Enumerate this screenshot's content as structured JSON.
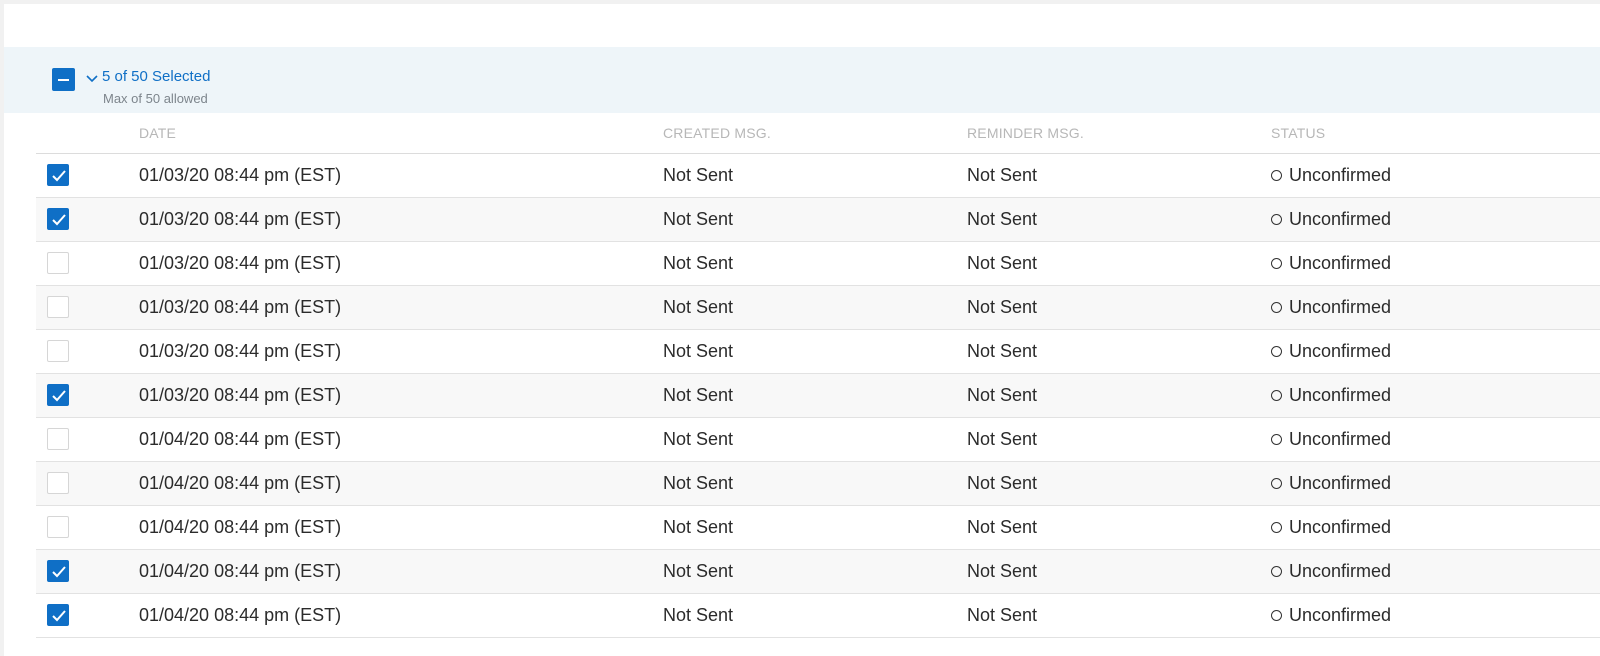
{
  "selection": {
    "summary": "5 of 50 Selected",
    "limit_note": "Max of 50 allowed"
  },
  "columns": {
    "date": "DATE",
    "created": "CREATED MSG.",
    "reminder": "REMINDER MSG.",
    "status": "STATUS"
  },
  "rows": [
    {
      "checked": true,
      "date": "01/03/20 08:44 pm (EST)",
      "created": "Not Sent",
      "reminder": "Not Sent",
      "status": "Unconfirmed"
    },
    {
      "checked": true,
      "date": "01/03/20 08:44 pm (EST)",
      "created": "Not Sent",
      "reminder": "Not Sent",
      "status": "Unconfirmed"
    },
    {
      "checked": false,
      "date": "01/03/20 08:44 pm (EST)",
      "created": "Not Sent",
      "reminder": "Not Sent",
      "status": "Unconfirmed"
    },
    {
      "checked": false,
      "date": "01/03/20 08:44 pm (EST)",
      "created": "Not Sent",
      "reminder": "Not Sent",
      "status": "Unconfirmed"
    },
    {
      "checked": false,
      "date": "01/03/20 08:44 pm (EST)",
      "created": "Not Sent",
      "reminder": "Not Sent",
      "status": "Unconfirmed"
    },
    {
      "checked": true,
      "date": "01/03/20 08:44 pm (EST)",
      "created": "Not Sent",
      "reminder": "Not Sent",
      "status": "Unconfirmed"
    },
    {
      "checked": false,
      "date": "01/04/20 08:44 pm (EST)",
      "created": "Not Sent",
      "reminder": "Not Sent",
      "status": "Unconfirmed"
    },
    {
      "checked": false,
      "date": "01/04/20 08:44 pm (EST)",
      "created": "Not Sent",
      "reminder": "Not Sent",
      "status": "Unconfirmed"
    },
    {
      "checked": false,
      "date": "01/04/20 08:44 pm (EST)",
      "created": "Not Sent",
      "reminder": "Not Sent",
      "status": "Unconfirmed"
    },
    {
      "checked": true,
      "date": "01/04/20 08:44 pm (EST)",
      "created": "Not Sent",
      "reminder": "Not Sent",
      "status": "Unconfirmed"
    },
    {
      "checked": true,
      "date": "01/04/20 08:44 pm (EST)",
      "created": "Not Sent",
      "reminder": "Not Sent",
      "status": "Unconfirmed"
    }
  ],
  "colors": {
    "accent": "#0f6fc6",
    "selection_bar_bg": "#eef5f9"
  },
  "icons": {
    "master": "minus-icon",
    "expand": "chevron-down-icon",
    "row_check": "checkmark-icon",
    "status": "circle-outline-icon"
  }
}
